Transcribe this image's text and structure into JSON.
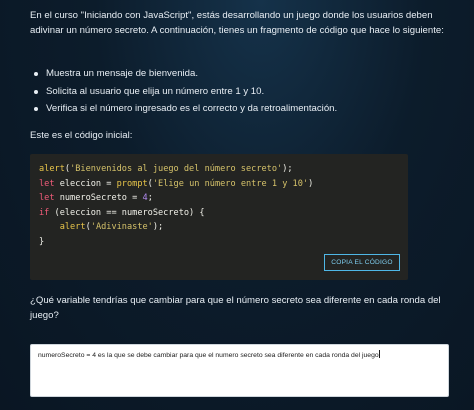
{
  "intro": "En el curso \"Iniciando con JavaScript\", estás desarrollando un juego donde los usuarios deben adivinar un número secreto. A continuación, tienes un fragmento de código que hace lo siguiente:",
  "bullets": [
    "Muestra un mensaje de bienvenida.",
    "Solicita al usuario que elija un número entre 1 y 10.",
    "Verifica si el número ingresado es el correcto y da retroalimentación."
  ],
  "initial_code_label": "Este es el código inicial:",
  "code": {
    "line1": {
      "fn": "alert",
      "open": "(",
      "str": "'Bienvenidos al juego del número secreto'",
      "close": ");"
    },
    "line2": {
      "kw": "let",
      "name": " eleccion = ",
      "fn": "prompt",
      "open": "(",
      "str": "'Elige un número entre 1 y 10'",
      "close": ")"
    },
    "line3": {
      "kw": "let",
      "name": " numeroSecreto = ",
      "num": "4",
      "close": ";"
    },
    "line4": {
      "kw": "if",
      "cond": " (eleccion == numeroSecreto) {"
    },
    "line5": {
      "indent": "    ",
      "fn": "alert",
      "open": "(",
      "str": "'Adivinaste'",
      "close": ");"
    },
    "line6": {
      "close": "}"
    }
  },
  "copy_button_label": "COPIA EL CÓDIGO",
  "question": "¿Qué variable tendrías que cambiar para que el número secreto sea diferente en cada ronda del juego?",
  "answer_value": "numeroSecreto = 4 es la que se debe cambiar para que el numero secreto sea diferente en cada ronda del juego"
}
